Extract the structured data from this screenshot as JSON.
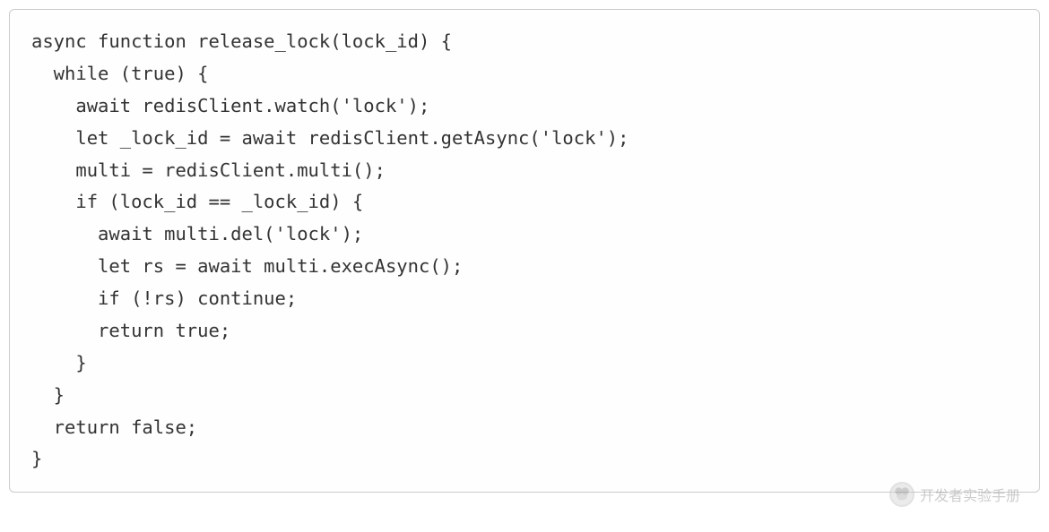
{
  "code": {
    "lines": [
      "async function release_lock(lock_id) {",
      "  while (true) {",
      "    await redisClient.watch('lock');",
      "    let _lock_id = await redisClient.getAsync('lock');",
      "    multi = redisClient.multi();",
      "    if (lock_id == _lock_id) {",
      "      await multi.del('lock');",
      "      let rs = await multi.execAsync();",
      "      if (!rs) continue;",
      "      return true;",
      "    }",
      "  }",
      "  return false;",
      "}"
    ]
  },
  "watermark": {
    "text": "开发者实验手册"
  }
}
